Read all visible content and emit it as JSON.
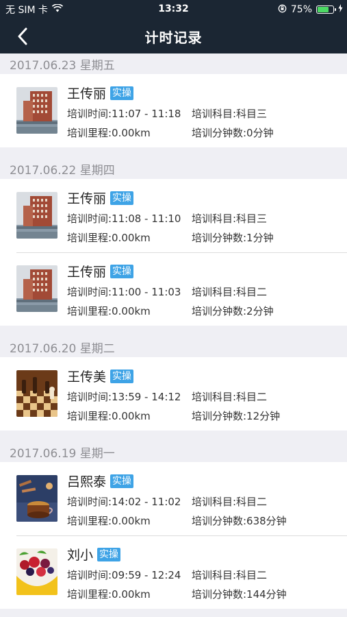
{
  "status": {
    "carrier": "无 SIM 卡",
    "time": "13:32",
    "battery": "75%",
    "battery_level": 0.75
  },
  "nav": {
    "title": "计时记录"
  },
  "groups": [
    {
      "date": "2017.06.23 星期五",
      "records": [
        {
          "name": "王传丽",
          "tag": "实操",
          "time": "培训时间:11:07 - 11:18",
          "subject": "培训科目:科目三",
          "mileage": "培训里程:0.00km",
          "minutes": "培训分钟数:0分钟",
          "thumb": "building"
        }
      ]
    },
    {
      "date": "2017.06.22 星期四",
      "records": [
        {
          "name": "王传丽",
          "tag": "实操",
          "time": "培训时间:11:08 - 11:10",
          "subject": "培训科目:科目三",
          "mileage": "培训里程:0.00km",
          "minutes": "培训分钟数:1分钟",
          "thumb": "building"
        },
        {
          "name": "王传丽",
          "tag": "实操",
          "time": "培训时间:11:00 - 11:03",
          "subject": "培训科目:科目二",
          "mileage": "培训里程:0.00km",
          "minutes": "培训分钟数:2分钟",
          "thumb": "building"
        }
      ]
    },
    {
      "date": "2017.06.20 星期二",
      "records": [
        {
          "name": "王传美",
          "tag": "实操",
          "time": "培训时间:13:59 - 14:12",
          "subject": "培训科目:科目二",
          "mileage": "培训里程:0.00km",
          "minutes": "培训分钟数:12分钟",
          "thumb": "chess"
        }
      ]
    },
    {
      "date": "2017.06.19 星期一",
      "records": [
        {
          "name": "吕熙泰",
          "tag": "实操",
          "time": "培训时间:14:02 - 11:02",
          "subject": "培训科目:科目二",
          "mileage": "培训里程:0.00km",
          "minutes": "培训分钟数:638分钟",
          "thumb": "tea"
        },
        {
          "name": "刘小",
          "tag": "实操",
          "time": "培训时间:09:59 - 12:24",
          "subject": "培训科目:科目二",
          "mileage": "培训里程:0.00km",
          "minutes": "培训分钟数:144分钟",
          "thumb": "fruit"
        }
      ]
    }
  ]
}
